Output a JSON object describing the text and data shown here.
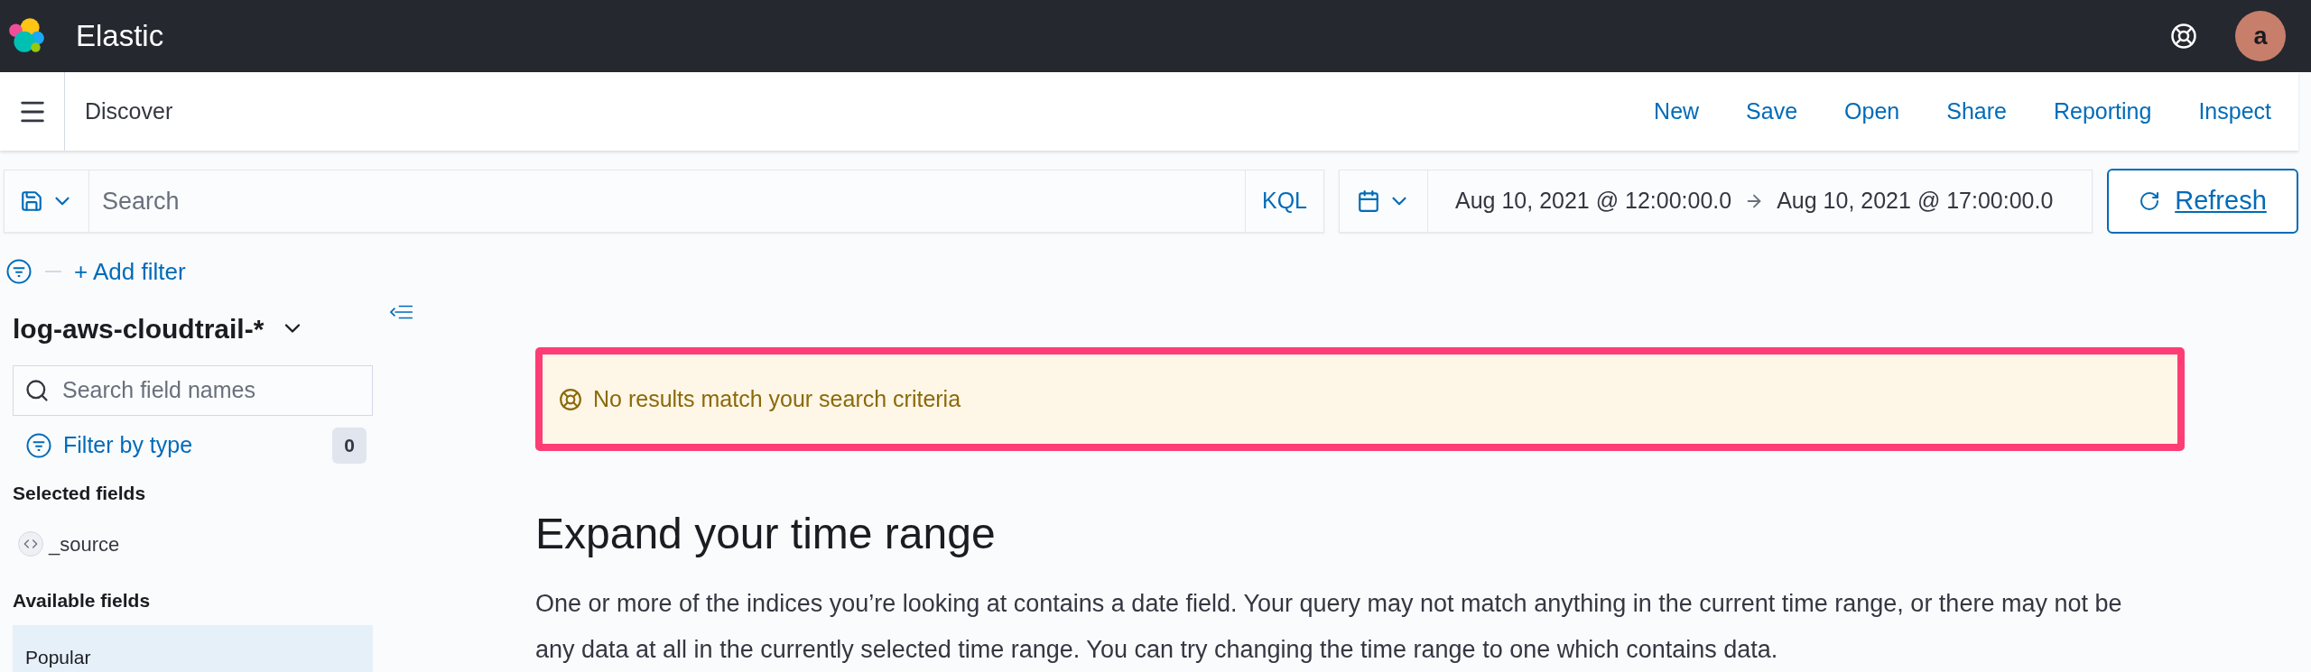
{
  "header": {
    "title": "Elastic",
    "avatar": "a"
  },
  "app_bar": {
    "title": "Discover",
    "actions": [
      "New",
      "Save",
      "Open",
      "Share",
      "Reporting",
      "Inspect"
    ]
  },
  "query_bar": {
    "placeholder": "Search",
    "language": "KQL",
    "start": "Aug 10, 2021 @ 12:00:00.0",
    "end": "Aug 10, 2021 @ 17:00:00.0",
    "refresh": "Refresh"
  },
  "filter_bar": {
    "add_filter": "+ Add filter"
  },
  "sidebar": {
    "index_pattern": "log-aws-cloudtrail-*",
    "search_placeholder": "Search field names",
    "filter_by_type": "Filter by type",
    "filter_count": "0",
    "selected_title": "Selected fields",
    "selected_fields": [
      "_source"
    ],
    "available_title": "Available fields",
    "popular_title": "Popular"
  },
  "callout": {
    "text": "No results match your search criteria"
  },
  "main": {
    "heading": "Expand your time range",
    "body": "One or more of the indices you’re looking at contains a date field. Your query may not match anything in the current time range, or there may not be any data at all in the currently selected time range. You can try changing the time range to one which contains data."
  }
}
